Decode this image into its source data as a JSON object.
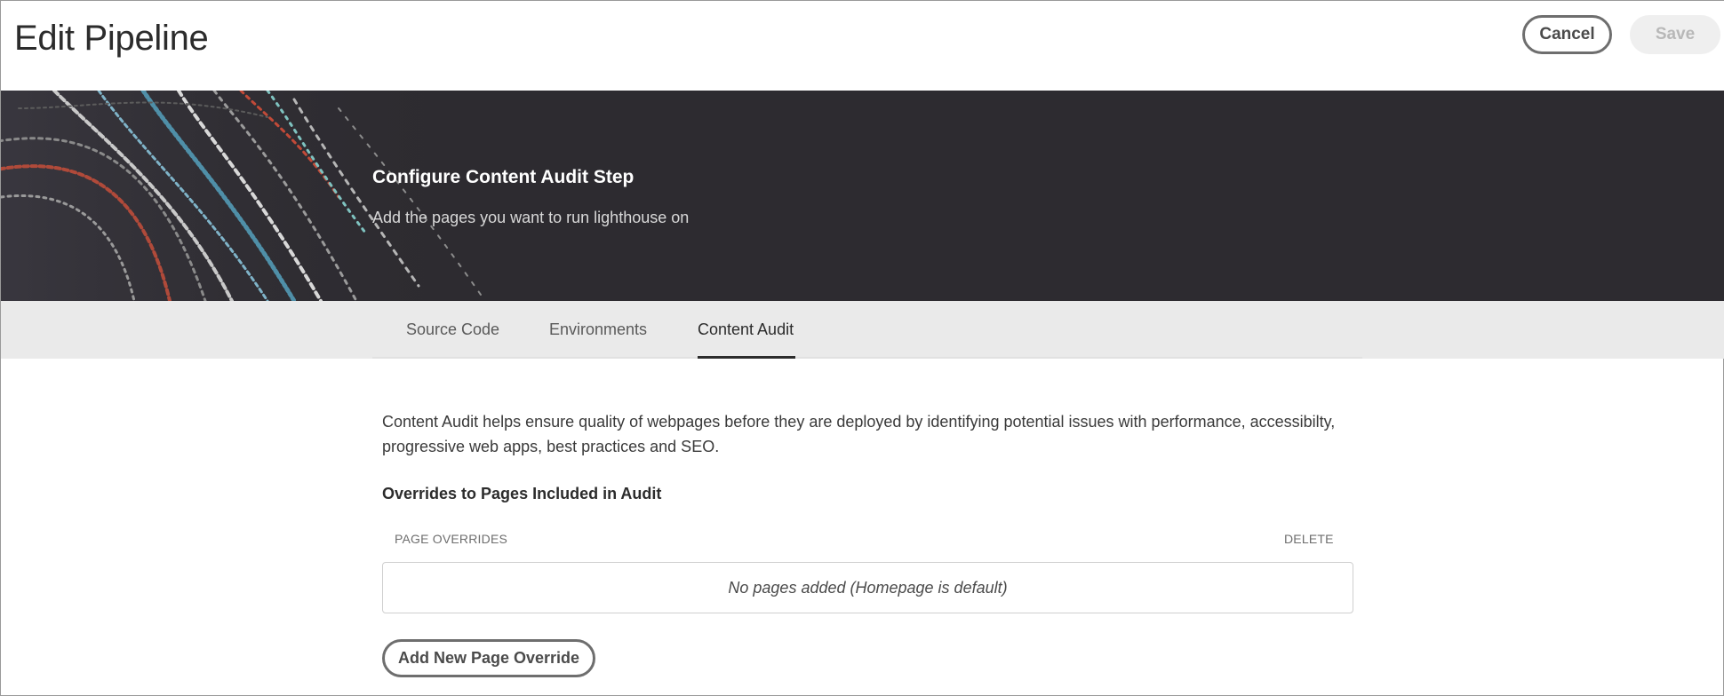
{
  "header": {
    "title": "Edit Pipeline",
    "cancel_label": "Cancel",
    "save_label": "Save"
  },
  "banner": {
    "title": "Configure Content Audit Step",
    "subtitle": "Add the pages you want to run lighthouse on"
  },
  "tabs": [
    {
      "label": "Source Code",
      "active": false
    },
    {
      "label": "Environments",
      "active": false
    },
    {
      "label": "Content Audit",
      "active": true
    }
  ],
  "content": {
    "description": "Content Audit helps ensure quality of webpages before they are deployed by identifying potential issues with performance, accessibilty, progressive web apps, best practices and SEO.",
    "section_title": "Overrides to Pages Included in Audit",
    "columns": {
      "page_overrides": "PAGE OVERRIDES",
      "delete": "DELETE"
    },
    "empty_message": "No pages added (Homepage is default)",
    "add_button_label": "Add New Page Override"
  },
  "colors": {
    "banner_bg": "#2d2b30",
    "tabbar_bg": "#eaeaea",
    "text": "#2c2c2c",
    "button_border": "#6e6e6e"
  }
}
